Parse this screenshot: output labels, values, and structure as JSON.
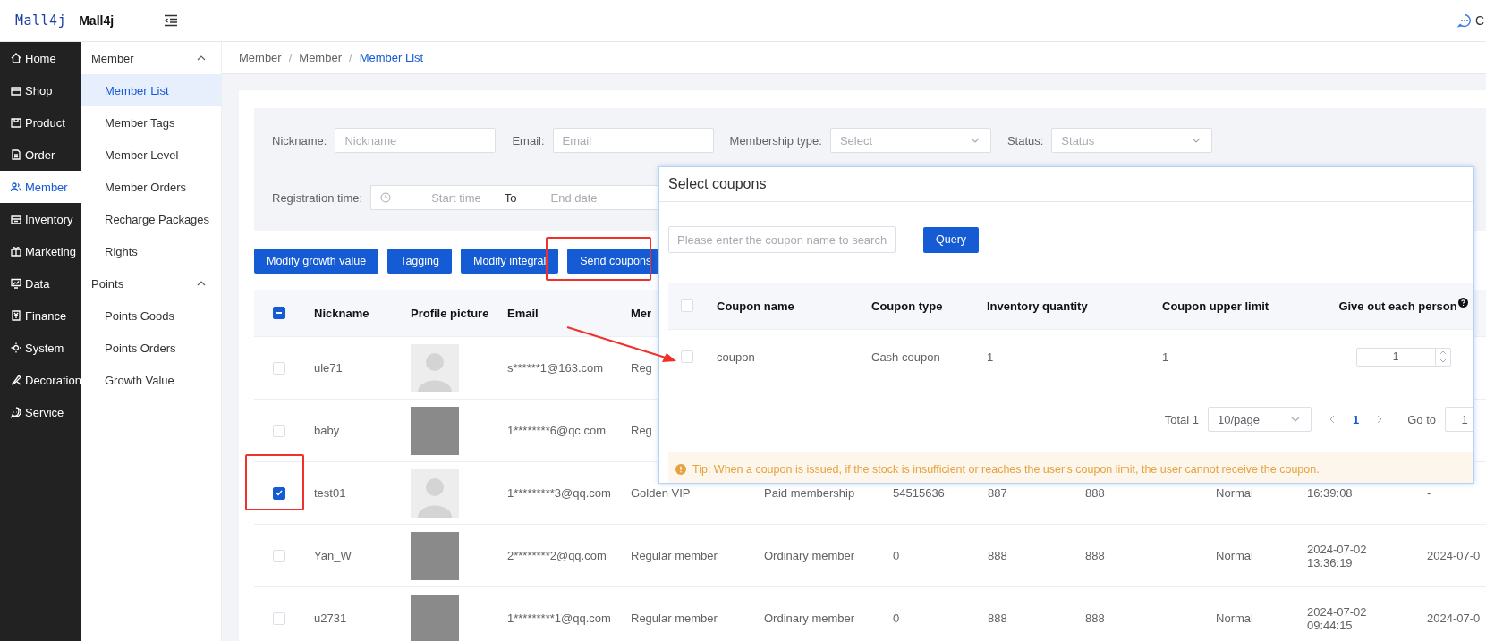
{
  "header": {
    "logo": "Mall4j",
    "title": "Mall4j",
    "right_text": "C"
  },
  "nav": [
    {
      "label": "Home",
      "selected": false
    },
    {
      "label": "Shop",
      "selected": false
    },
    {
      "label": "Product",
      "selected": false
    },
    {
      "label": "Order",
      "selected": false
    },
    {
      "label": "Member",
      "selected": true
    },
    {
      "label": "Inventory",
      "selected": false
    },
    {
      "label": "Marketing",
      "selected": false
    },
    {
      "label": "Data",
      "selected": false
    },
    {
      "label": "Finance",
      "selected": false
    },
    {
      "label": "System",
      "selected": false
    },
    {
      "label": "Decoration",
      "selected": false
    },
    {
      "label": "Service",
      "selected": false
    }
  ],
  "submenu": [
    {
      "label": "Member",
      "expanded": true,
      "children": [
        {
          "label": "Member List",
          "selected": true
        },
        {
          "label": "Member Tags",
          "selected": false
        },
        {
          "label": "Member Level",
          "selected": false
        },
        {
          "label": "Member Orders",
          "selected": false
        },
        {
          "label": "Recharge Packages",
          "selected": false
        },
        {
          "label": "Rights",
          "selected": false
        }
      ]
    },
    {
      "label": "Points",
      "expanded": true,
      "children": [
        {
          "label": "Points Goods",
          "selected": false
        },
        {
          "label": "Points Orders",
          "selected": false
        },
        {
          "label": "Growth Value",
          "selected": false
        }
      ]
    }
  ],
  "breadcrumb": {
    "separator": "/",
    "items": [
      {
        "label": "Member",
        "current": false
      },
      {
        "label": "Member",
        "current": false
      },
      {
        "label": "Member List",
        "current": true
      }
    ]
  },
  "filters": [
    {
      "label": "Nickname:",
      "placeholder": "Nickname",
      "kind": "input"
    },
    {
      "label": "Email:",
      "placeholder": "Email",
      "kind": "input"
    },
    {
      "label": "Membership type:",
      "placeholder": "Select",
      "kind": "select"
    },
    {
      "label": "Status:",
      "placeholder": "Status",
      "kind": "select"
    }
  ],
  "date_filter": {
    "label": "Registration time:",
    "start_placeholder": "Start time",
    "separator": "To",
    "end_placeholder": "End date"
  },
  "actions": [
    "Modify growth value",
    "Tagging",
    "Modify integral",
    "Send coupons"
  ],
  "table": {
    "select_all": {
      "indeterminate": true
    },
    "columns": [
      "Nickname",
      "Profile picture",
      "Email",
      "Mer"
    ],
    "rows": [
      {
        "selected": false,
        "picture": {
          "kind": "avatar"
        },
        "cells": [
          "ule71",
          "",
          "s******1@163.com",
          "Reg"
        ]
      },
      {
        "selected": false,
        "picture": {
          "kind": "photo"
        },
        "cells": [
          "baby",
          "",
          "1********6@qc.com",
          "Reg"
        ]
      },
      {
        "selected": true,
        "picture": {
          "kind": "avatar"
        },
        "cells": [
          "test01",
          "",
          "1*********3@qq.com",
          "Golden VIP",
          "Paid membership",
          "54515636",
          "887",
          "888",
          "Normal",
          "16:39:08",
          "-"
        ]
      },
      {
        "selected": false,
        "picture": {
          "kind": "photo"
        },
        "cells": [
          "Yan_W",
          "",
          "2********2@qq.com",
          "Regular member",
          "Ordinary member",
          "0",
          "888",
          "888",
          "Normal",
          "2024-07-02 13:36:19",
          "2024-07-0"
        ]
      },
      {
        "selected": false,
        "picture": {
          "kind": "photo"
        },
        "cells": [
          "u2731",
          "",
          "1*********1@qq.com",
          "Regular member",
          "Ordinary member",
          "0",
          "888",
          "888",
          "Normal",
          "2024-07-02 09:44:15",
          "2024-07-0"
        ]
      }
    ]
  },
  "coupon_dialog": {
    "title": "Select coupons",
    "search_placeholder": "Please enter the coupon name to search",
    "query": "Query",
    "select_all": {
      "checked": false
    },
    "columns": [
      "Coupon name",
      "Coupon type",
      "Inventory quantity",
      "Coupon upper limit",
      "Give out each person"
    ],
    "rows": [
      {
        "selected": false,
        "name": "coupon",
        "type": "Cash coupon",
        "inventory": "1",
        "limit": "1",
        "quantity": "1"
      }
    ],
    "pagination": {
      "total": "Total 1",
      "page_size": "10/page",
      "pages": [
        {
          "label": "1",
          "selected": true
        }
      ],
      "goto_label": "Go to",
      "goto_value": "1"
    },
    "tip": "Tip: When a coupon is issued, if the stock is insufficient or reaches the user's coupon limit, the user cannot receive the coupon."
  }
}
